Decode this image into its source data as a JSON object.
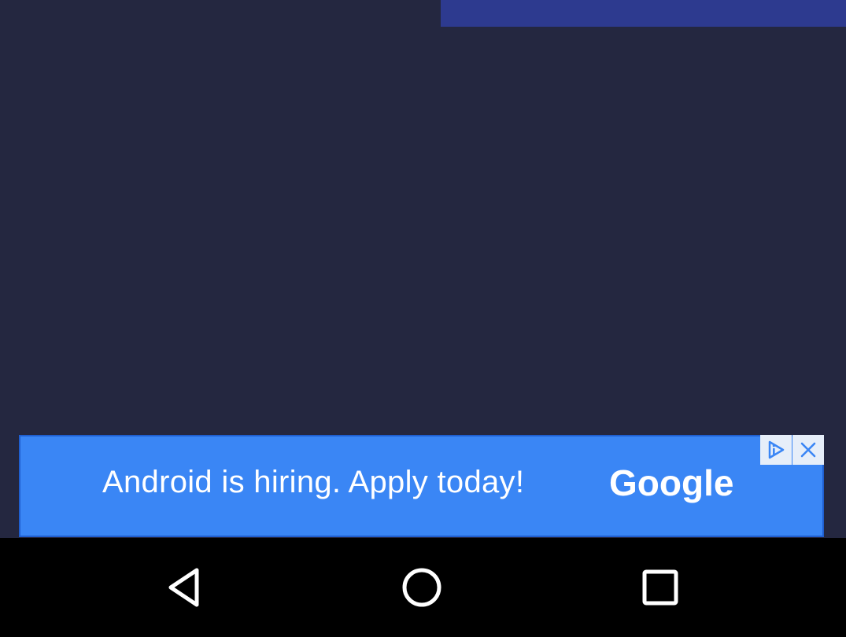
{
  "colors": {
    "background": "#242740",
    "top_bar": "#2d3a8f",
    "ad_background": "#3a86f5",
    "ad_text": "#ffffff",
    "nav_bar": "#000000",
    "nav_icon": "#ffffff"
  },
  "ad": {
    "text": "Android is hiring. Apply today!",
    "brand": "Google",
    "choices_icon": "ad-choices-icon",
    "close_icon": "close-icon"
  },
  "navigation": {
    "back_icon": "back-triangle-icon",
    "home_icon": "home-circle-icon",
    "recents_icon": "recents-square-icon"
  }
}
